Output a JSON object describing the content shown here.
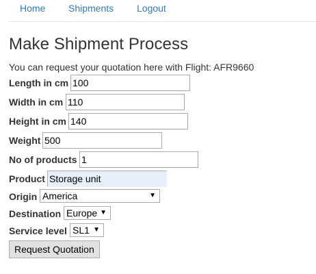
{
  "nav": {
    "home": "Home",
    "shipments": "Shipments",
    "logout": "Logout"
  },
  "page": {
    "title": "Make Shipment Process",
    "intro": "You can request your quotation here with Flight: AFR9660"
  },
  "form": {
    "length": {
      "label": "Length in cm",
      "value": "100"
    },
    "width": {
      "label": "Width in cm",
      "value": "110"
    },
    "height": {
      "label": "Height in cm",
      "value": "140"
    },
    "weight": {
      "label": "Weight",
      "value": "500"
    },
    "products": {
      "label": "No of products",
      "value": "1"
    },
    "product": {
      "label": "Product",
      "value": "Storage unit"
    },
    "origin": {
      "label": "Origin",
      "value": "America"
    },
    "destination": {
      "label": "Destination",
      "value": "Europe"
    },
    "service": {
      "label": "Service level",
      "value": "SL1"
    },
    "submit_label": "Request Quotation"
  },
  "icons": {
    "dropdown": "chevron-down-icon"
  },
  "colors": {
    "link": "#337ab7",
    "readonly_field": "#e8f0fe"
  }
}
